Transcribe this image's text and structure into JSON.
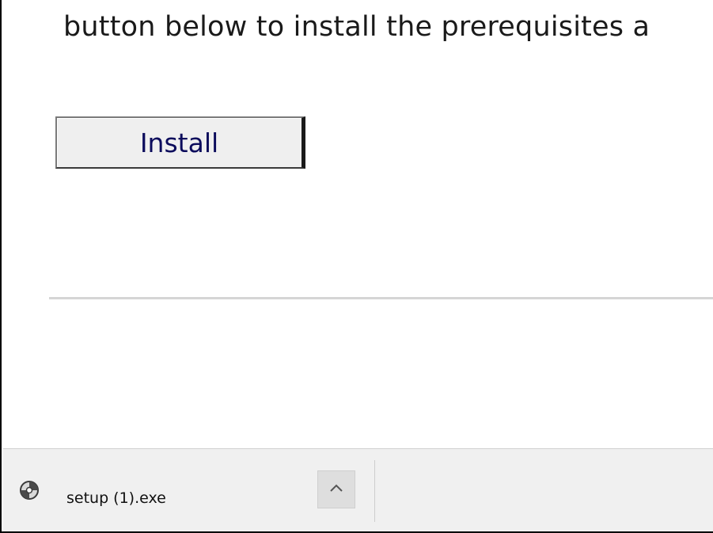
{
  "installer": {
    "intro_text": "button below to install the prerequisites a",
    "install_button_label": "Install"
  },
  "download_bar": {
    "items": [
      {
        "file_name": "setup (1).exe",
        "icon": "installer-disc-icon",
        "menu_icon": "chevron-up-icon"
      }
    ]
  }
}
